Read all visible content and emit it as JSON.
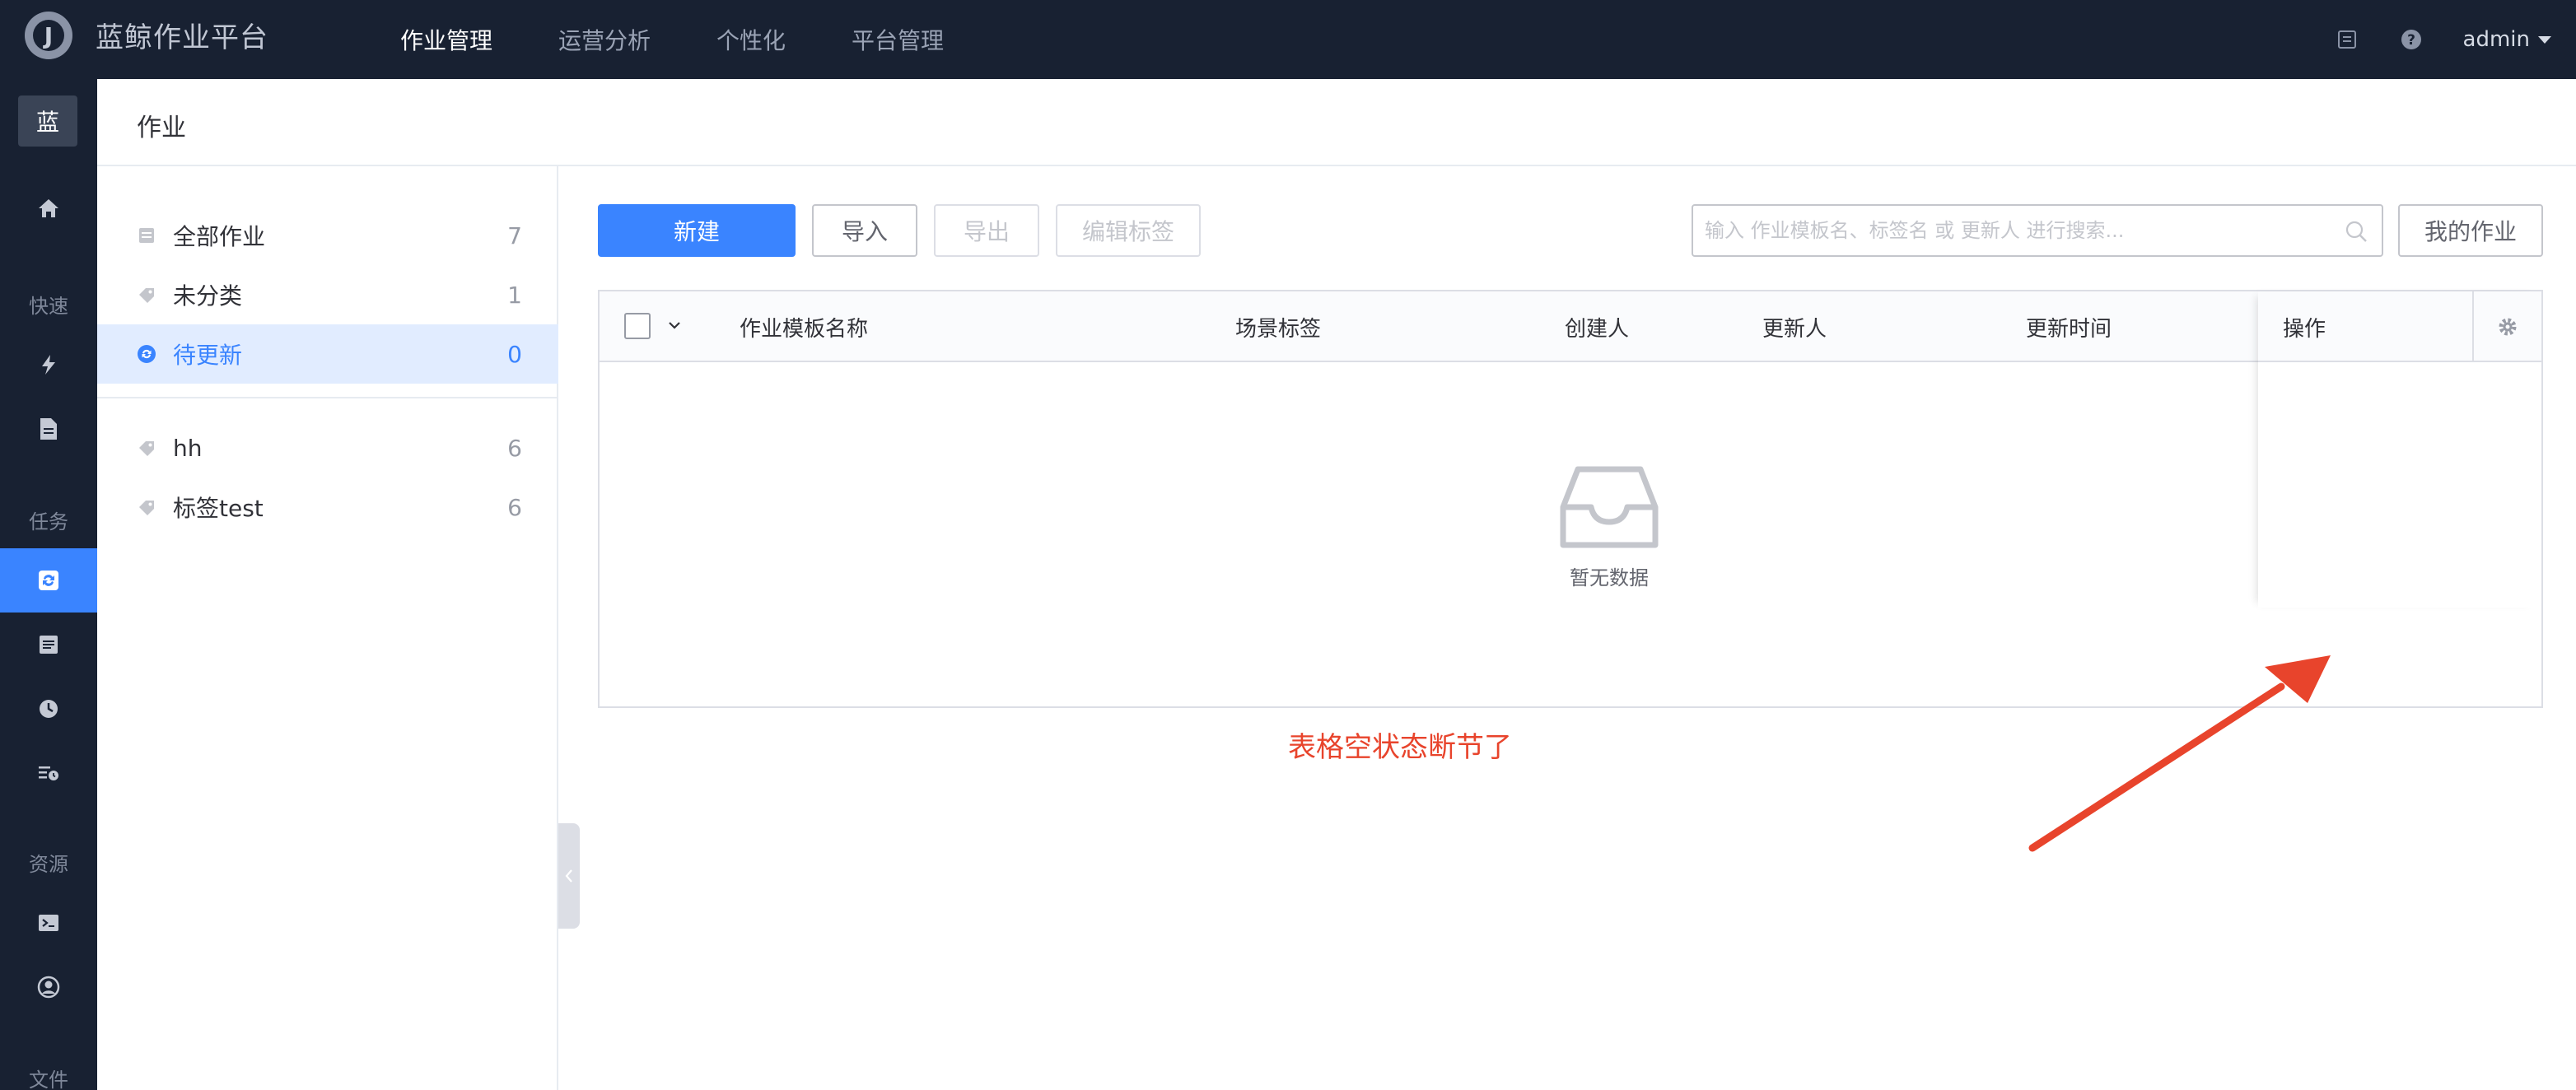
{
  "app": {
    "title": "蓝鲸作业平台",
    "logo_letter": "J"
  },
  "topnav": {
    "items": [
      {
        "label": "作业管理"
      },
      {
        "label": "运营分析"
      },
      {
        "label": "个性化"
      },
      {
        "label": "平台管理"
      }
    ],
    "active_index": 0
  },
  "user": {
    "name": "admin"
  },
  "sidebar": {
    "brand": "蓝",
    "groups": {
      "quick": "快速",
      "task": "任务",
      "resource": "资源",
      "file": "文件"
    },
    "icons": [
      "home-icon",
      "lightning-icon",
      "file-icon",
      "task-sync-icon",
      "list-icon",
      "clock-icon",
      "schedule-list-icon",
      "terminal-icon",
      "account-icon"
    ],
    "active_icon": "task-sync-icon"
  },
  "page": {
    "title": "作业"
  },
  "categories": [
    {
      "label": "全部作业",
      "count": "7",
      "icon": "stack-icon"
    },
    {
      "label": "未分类",
      "count": "1",
      "icon": "tag-icon"
    },
    {
      "label": "待更新",
      "count": "0",
      "icon": "sync-icon",
      "active": true
    },
    {
      "label": "hh",
      "count": "6",
      "icon": "tag-icon"
    },
    {
      "label": "标签test",
      "count": "6",
      "icon": "tag-icon"
    }
  ],
  "toolbar": {
    "new_label": "新建",
    "import_label": "导入",
    "export_label": "导出",
    "edit_tag_label": "编辑标签",
    "search_placeholder": "输入 作业模板名、标签名 或 更新人 进行搜索...",
    "my_jobs_label": "我的作业"
  },
  "table": {
    "columns": [
      "作业模板名称",
      "场景标签",
      "创建人",
      "更新人",
      "更新时间"
    ],
    "operations_header": "操作",
    "empty_text": "暂无数据"
  },
  "annotation": {
    "text": "表格空状态断节了",
    "color": "#e8442c"
  },
  "colors": {
    "primary": "#3a84ff",
    "topbar": "#182132"
  }
}
